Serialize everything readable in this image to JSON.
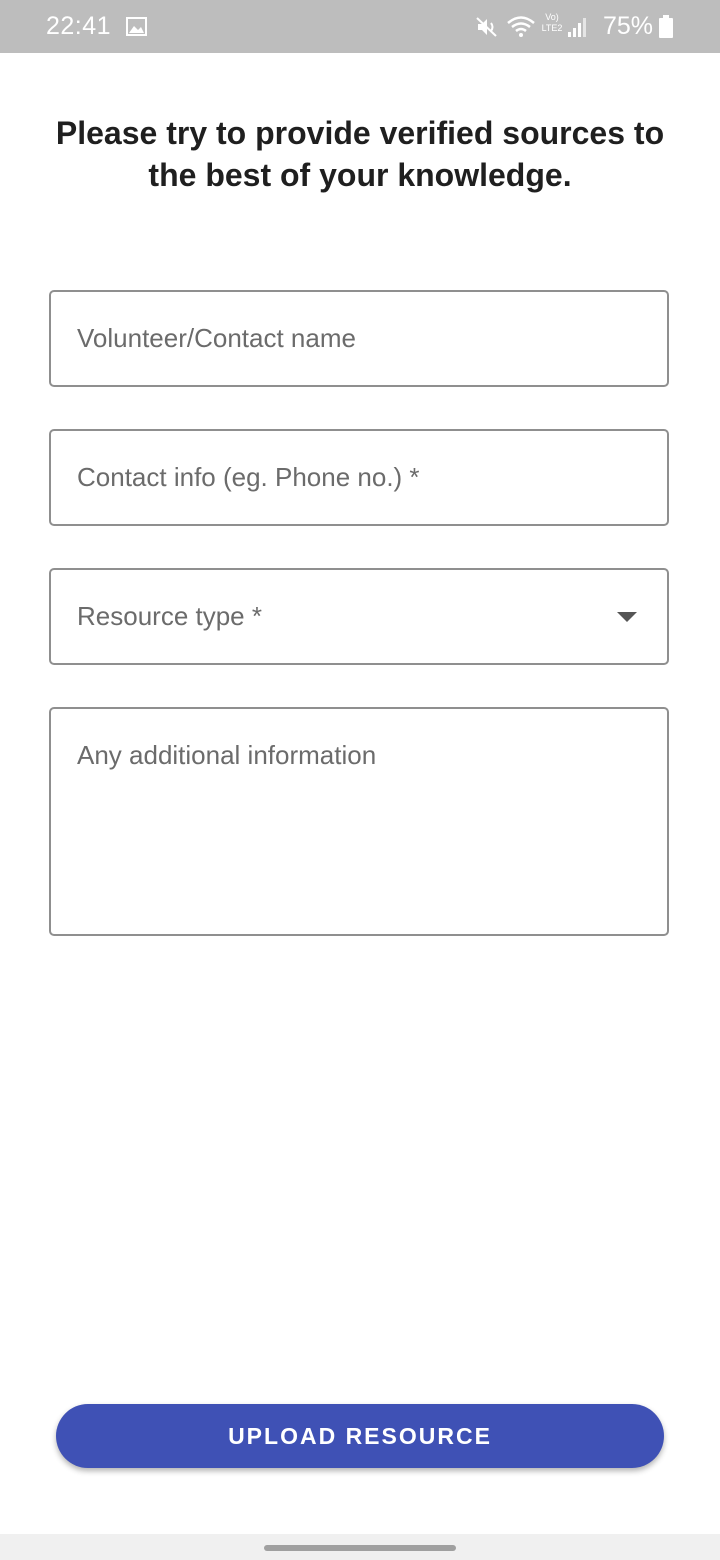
{
  "status_bar": {
    "time": "22:41",
    "network": "Vo) LTE2",
    "battery_percent": "75%",
    "icons": [
      "gallery-icon",
      "mute-icon",
      "wifi-icon",
      "signal-icon",
      "battery-icon"
    ]
  },
  "heading": "Please try to provide verified sources to the best of your knowledge.",
  "form": {
    "name_placeholder": "Volunteer/Contact name",
    "contact_placeholder": "Contact info (eg. Phone no.) *",
    "resource_type_label": "Resource type *",
    "info_placeholder": "Any additional information"
  },
  "upload_button_label": "UPLOAD RESOURCE",
  "colors": {
    "primary": "#3f51b5",
    "status_bar": "#bdbdbd",
    "field_border": "#8f8f8f"
  }
}
